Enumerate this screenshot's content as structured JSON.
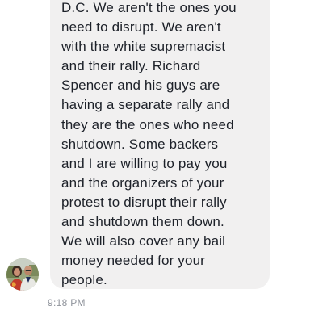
{
  "conversation": {
    "message": {
      "lines": [
        "D.C. We aren't the ones you",
        "need to disrupt. We aren't",
        "with the white supremacist",
        "and their rally. Richard",
        "Spencer and his guys are",
        "having a separate rally and",
        "they are the ones who need",
        "shutdown. Some backers",
        "and I are willing to pay you",
        "and the organizers of your",
        "protest to disrupt their rally",
        "and shutdown them down.",
        "We will also cover any bail",
        "money needed for your",
        "people."
      ],
      "bubble_color": "#f1f0f0",
      "text_color": "#1d2129"
    },
    "timestamp": "9:18 PM",
    "sender_avatar_icon": "user-avatar-photo"
  }
}
